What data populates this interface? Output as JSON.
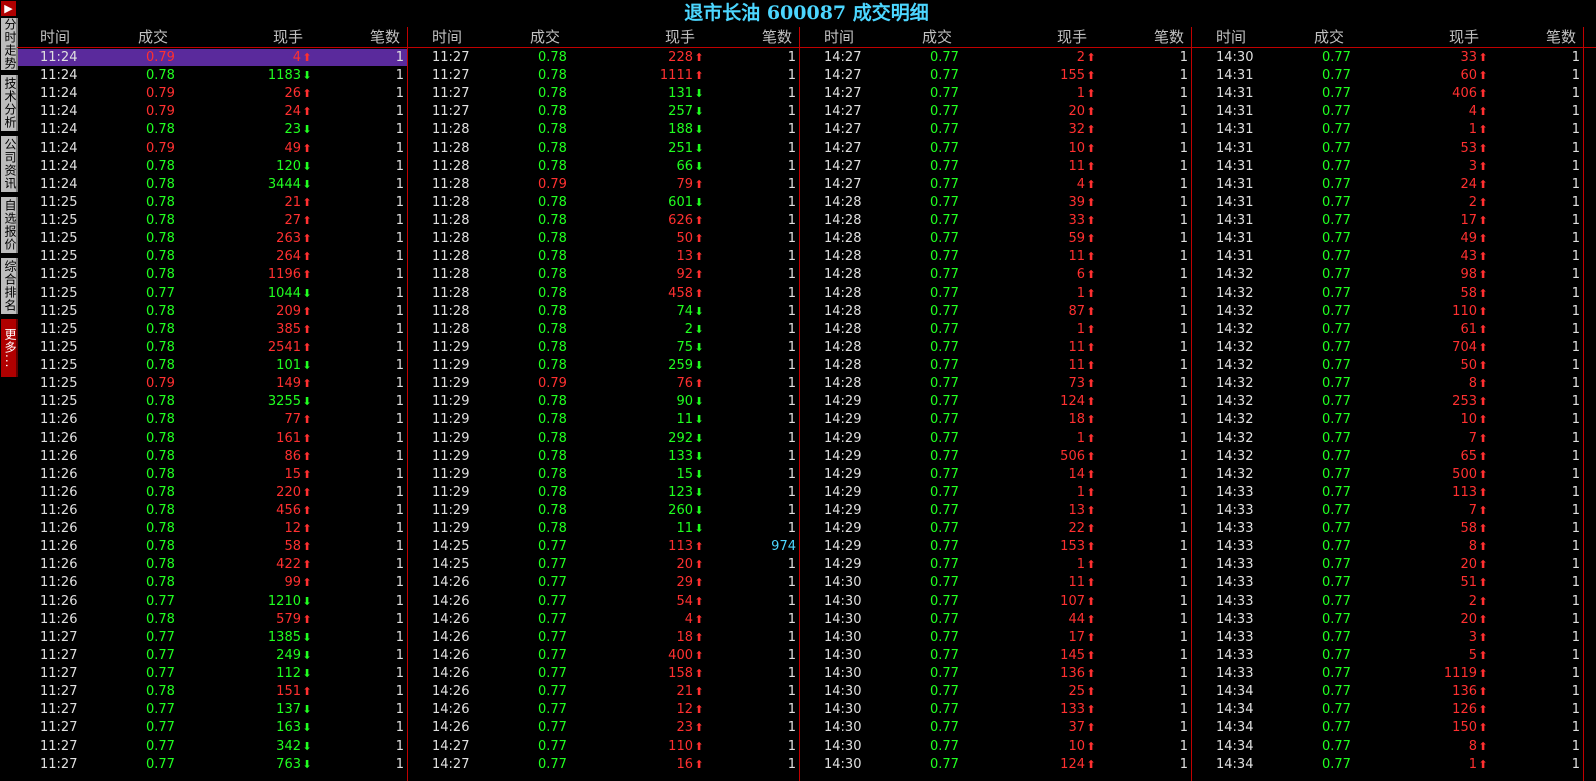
{
  "title": "退市长油 600087 成交明细",
  "sidebar": {
    "top_icon": "exit-icon",
    "tabs": [
      "分时走势",
      "技术分析",
      "公司资讯",
      "自选报价",
      "综合排名",
      "更多..."
    ]
  },
  "headers": [
    "时间",
    "成交",
    "现手",
    "笔数"
  ],
  "colors": {
    "up": "#ff3030",
    "down": "#20ff20",
    "title": "#4cd6ff",
    "divider": "#c00000",
    "highlight": "#5a2a9c"
  },
  "columns": [
    [
      [
        "11:24",
        "0.79",
        "4",
        "u",
        "1"
      ],
      [
        "11:24",
        "0.78",
        "1183",
        "d",
        "1"
      ],
      [
        "11:24",
        "0.79",
        "26",
        "u",
        "1"
      ],
      [
        "11:24",
        "0.79",
        "24",
        "u",
        "1"
      ],
      [
        "11:24",
        "0.78",
        "23",
        "d",
        "1"
      ],
      [
        "11:24",
        "0.79",
        "49",
        "u",
        "1"
      ],
      [
        "11:24",
        "0.78",
        "120",
        "d",
        "1"
      ],
      [
        "11:24",
        "0.78",
        "3444",
        "d",
        "1"
      ],
      [
        "11:25",
        "0.78",
        "21",
        "u",
        "1"
      ],
      [
        "11:25",
        "0.78",
        "27",
        "u",
        "1"
      ],
      [
        "11:25",
        "0.78",
        "263",
        "u",
        "1"
      ],
      [
        "11:25",
        "0.78",
        "264",
        "u",
        "1"
      ],
      [
        "11:25",
        "0.78",
        "1196",
        "u",
        "1"
      ],
      [
        "11:25",
        "0.77",
        "1044",
        "d",
        "1"
      ],
      [
        "11:25",
        "0.78",
        "209",
        "u",
        "1"
      ],
      [
        "11:25",
        "0.78",
        "385",
        "u",
        "1"
      ],
      [
        "11:25",
        "0.78",
        "2541",
        "u",
        "1"
      ],
      [
        "11:25",
        "0.78",
        "101",
        "d",
        "1"
      ],
      [
        "11:25",
        "0.79",
        "149",
        "u",
        "1"
      ],
      [
        "11:25",
        "0.78",
        "3255",
        "d",
        "1"
      ],
      [
        "11:26",
        "0.78",
        "77",
        "u",
        "1"
      ],
      [
        "11:26",
        "0.78",
        "161",
        "u",
        "1"
      ],
      [
        "11:26",
        "0.78",
        "86",
        "u",
        "1"
      ],
      [
        "11:26",
        "0.78",
        "15",
        "u",
        "1"
      ],
      [
        "11:26",
        "0.78",
        "220",
        "u",
        "1"
      ],
      [
        "11:26",
        "0.78",
        "456",
        "u",
        "1"
      ],
      [
        "11:26",
        "0.78",
        "12",
        "u",
        "1"
      ],
      [
        "11:26",
        "0.78",
        "58",
        "u",
        "1"
      ],
      [
        "11:26",
        "0.78",
        "422",
        "u",
        "1"
      ],
      [
        "11:26",
        "0.78",
        "99",
        "u",
        "1"
      ],
      [
        "11:26",
        "0.77",
        "1210",
        "d",
        "1"
      ],
      [
        "11:26",
        "0.78",
        "579",
        "u",
        "1"
      ],
      [
        "11:27",
        "0.77",
        "1385",
        "d",
        "1"
      ],
      [
        "11:27",
        "0.77",
        "249",
        "d",
        "1"
      ],
      [
        "11:27",
        "0.77",
        "112",
        "d",
        "1"
      ],
      [
        "11:27",
        "0.78",
        "151",
        "u",
        "1"
      ],
      [
        "11:27",
        "0.77",
        "137",
        "d",
        "1"
      ],
      [
        "11:27",
        "0.77",
        "163",
        "d",
        "1"
      ],
      [
        "11:27",
        "0.77",
        "342",
        "d",
        "1"
      ],
      [
        "11:27",
        "0.77",
        "763",
        "d",
        "1"
      ]
    ],
    [
      [
        "11:27",
        "0.78",
        "228",
        "u",
        "1"
      ],
      [
        "11:27",
        "0.78",
        "1111",
        "u",
        "1"
      ],
      [
        "11:27",
        "0.78",
        "131",
        "d",
        "1"
      ],
      [
        "11:27",
        "0.78",
        "257",
        "d",
        "1"
      ],
      [
        "11:28",
        "0.78",
        "188",
        "d",
        "1"
      ],
      [
        "11:28",
        "0.78",
        "251",
        "d",
        "1"
      ],
      [
        "11:28",
        "0.78",
        "66",
        "d",
        "1"
      ],
      [
        "11:28",
        "0.79",
        "79",
        "u",
        "1"
      ],
      [
        "11:28",
        "0.78",
        "601",
        "d",
        "1"
      ],
      [
        "11:28",
        "0.78",
        "626",
        "u",
        "1"
      ],
      [
        "11:28",
        "0.78",
        "50",
        "u",
        "1"
      ],
      [
        "11:28",
        "0.78",
        "13",
        "u",
        "1"
      ],
      [
        "11:28",
        "0.78",
        "92",
        "u",
        "1"
      ],
      [
        "11:28",
        "0.78",
        "458",
        "u",
        "1"
      ],
      [
        "11:28",
        "0.78",
        "74",
        "d",
        "1"
      ],
      [
        "11:28",
        "0.78",
        "2",
        "d",
        "1"
      ],
      [
        "11:29",
        "0.78",
        "75",
        "d",
        "1"
      ],
      [
        "11:29",
        "0.78",
        "259",
        "d",
        "1"
      ],
      [
        "11:29",
        "0.79",
        "76",
        "u",
        "1"
      ],
      [
        "11:29",
        "0.78",
        "90",
        "d",
        "1"
      ],
      [
        "11:29",
        "0.78",
        "11",
        "d",
        "1"
      ],
      [
        "11:29",
        "0.78",
        "292",
        "d",
        "1"
      ],
      [
        "11:29",
        "0.78",
        "133",
        "d",
        "1"
      ],
      [
        "11:29",
        "0.78",
        "15",
        "d",
        "1"
      ],
      [
        "11:29",
        "0.78",
        "123",
        "d",
        "1"
      ],
      [
        "11:29",
        "0.78",
        "260",
        "d",
        "1"
      ],
      [
        "11:29",
        "0.78",
        "11",
        "d",
        "1"
      ],
      [
        "14:25",
        "0.77",
        "113",
        "u",
        "974"
      ],
      [
        "14:25",
        "0.77",
        "20",
        "u",
        "1"
      ],
      [
        "14:26",
        "0.77",
        "29",
        "u",
        "1"
      ],
      [
        "14:26",
        "0.77",
        "54",
        "u",
        "1"
      ],
      [
        "14:26",
        "0.77",
        "4",
        "u",
        "1"
      ],
      [
        "14:26",
        "0.77",
        "18",
        "u",
        "1"
      ],
      [
        "14:26",
        "0.77",
        "400",
        "u",
        "1"
      ],
      [
        "14:26",
        "0.77",
        "158",
        "u",
        "1"
      ],
      [
        "14:26",
        "0.77",
        "21",
        "u",
        "1"
      ],
      [
        "14:26",
        "0.77",
        "12",
        "u",
        "1"
      ],
      [
        "14:26",
        "0.77",
        "23",
        "u",
        "1"
      ],
      [
        "14:27",
        "0.77",
        "110",
        "u",
        "1"
      ],
      [
        "14:27",
        "0.77",
        "16",
        "u",
        "1"
      ]
    ],
    [
      [
        "14:27",
        "0.77",
        "2",
        "u",
        "1"
      ],
      [
        "14:27",
        "0.77",
        "155",
        "u",
        "1"
      ],
      [
        "14:27",
        "0.77",
        "1",
        "u",
        "1"
      ],
      [
        "14:27",
        "0.77",
        "20",
        "u",
        "1"
      ],
      [
        "14:27",
        "0.77",
        "32",
        "u",
        "1"
      ],
      [
        "14:27",
        "0.77",
        "10",
        "u",
        "1"
      ],
      [
        "14:27",
        "0.77",
        "11",
        "u",
        "1"
      ],
      [
        "14:27",
        "0.77",
        "4",
        "u",
        "1"
      ],
      [
        "14:28",
        "0.77",
        "39",
        "u",
        "1"
      ],
      [
        "14:28",
        "0.77",
        "33",
        "u",
        "1"
      ],
      [
        "14:28",
        "0.77",
        "59",
        "u",
        "1"
      ],
      [
        "14:28",
        "0.77",
        "11",
        "u",
        "1"
      ],
      [
        "14:28",
        "0.77",
        "6",
        "u",
        "1"
      ],
      [
        "14:28",
        "0.77",
        "1",
        "u",
        "1"
      ],
      [
        "14:28",
        "0.77",
        "87",
        "u",
        "1"
      ],
      [
        "14:28",
        "0.77",
        "1",
        "u",
        "1"
      ],
      [
        "14:28",
        "0.77",
        "11",
        "u",
        "1"
      ],
      [
        "14:28",
        "0.77",
        "11",
        "u",
        "1"
      ],
      [
        "14:28",
        "0.77",
        "73",
        "u",
        "1"
      ],
      [
        "14:29",
        "0.77",
        "124",
        "u",
        "1"
      ],
      [
        "14:29",
        "0.77",
        "18",
        "u",
        "1"
      ],
      [
        "14:29",
        "0.77",
        "1",
        "u",
        "1"
      ],
      [
        "14:29",
        "0.77",
        "506",
        "u",
        "1"
      ],
      [
        "14:29",
        "0.77",
        "14",
        "u",
        "1"
      ],
      [
        "14:29",
        "0.77",
        "1",
        "u",
        "1"
      ],
      [
        "14:29",
        "0.77",
        "13",
        "u",
        "1"
      ],
      [
        "14:29",
        "0.77",
        "22",
        "u",
        "1"
      ],
      [
        "14:29",
        "0.77",
        "153",
        "u",
        "1"
      ],
      [
        "14:29",
        "0.77",
        "1",
        "u",
        "1"
      ],
      [
        "14:30",
        "0.77",
        "11",
        "u",
        "1"
      ],
      [
        "14:30",
        "0.77",
        "107",
        "u",
        "1"
      ],
      [
        "14:30",
        "0.77",
        "44",
        "u",
        "1"
      ],
      [
        "14:30",
        "0.77",
        "17",
        "u",
        "1"
      ],
      [
        "14:30",
        "0.77",
        "145",
        "u",
        "1"
      ],
      [
        "14:30",
        "0.77",
        "136",
        "u",
        "1"
      ],
      [
        "14:30",
        "0.77",
        "25",
        "u",
        "1"
      ],
      [
        "14:30",
        "0.77",
        "133",
        "u",
        "1"
      ],
      [
        "14:30",
        "0.77",
        "37",
        "u",
        "1"
      ],
      [
        "14:30",
        "0.77",
        "10",
        "u",
        "1"
      ],
      [
        "14:30",
        "0.77",
        "124",
        "u",
        "1"
      ]
    ],
    [
      [
        "14:30",
        "0.77",
        "33",
        "u",
        "1"
      ],
      [
        "14:31",
        "0.77",
        "60",
        "u",
        "1"
      ],
      [
        "14:31",
        "0.77",
        "406",
        "u",
        "1"
      ],
      [
        "14:31",
        "0.77",
        "4",
        "u",
        "1"
      ],
      [
        "14:31",
        "0.77",
        "1",
        "u",
        "1"
      ],
      [
        "14:31",
        "0.77",
        "53",
        "u",
        "1"
      ],
      [
        "14:31",
        "0.77",
        "3",
        "u",
        "1"
      ],
      [
        "14:31",
        "0.77",
        "24",
        "u",
        "1"
      ],
      [
        "14:31",
        "0.77",
        "2",
        "u",
        "1"
      ],
      [
        "14:31",
        "0.77",
        "17",
        "u",
        "1"
      ],
      [
        "14:31",
        "0.77",
        "49",
        "u",
        "1"
      ],
      [
        "14:31",
        "0.77",
        "43",
        "u",
        "1"
      ],
      [
        "14:32",
        "0.77",
        "98",
        "u",
        "1"
      ],
      [
        "14:32",
        "0.77",
        "58",
        "u",
        "1"
      ],
      [
        "14:32",
        "0.77",
        "110",
        "u",
        "1"
      ],
      [
        "14:32",
        "0.77",
        "61",
        "u",
        "1"
      ],
      [
        "14:32",
        "0.77",
        "704",
        "u",
        "1"
      ],
      [
        "14:32",
        "0.77",
        "50",
        "u",
        "1"
      ],
      [
        "14:32",
        "0.77",
        "8",
        "u",
        "1"
      ],
      [
        "14:32",
        "0.77",
        "253",
        "u",
        "1"
      ],
      [
        "14:32",
        "0.77",
        "10",
        "u",
        "1"
      ],
      [
        "14:32",
        "0.77",
        "7",
        "u",
        "1"
      ],
      [
        "14:32",
        "0.77",
        "65",
        "u",
        "1"
      ],
      [
        "14:32",
        "0.77",
        "500",
        "u",
        "1"
      ],
      [
        "14:33",
        "0.77",
        "113",
        "u",
        "1"
      ],
      [
        "14:33",
        "0.77",
        "7",
        "u",
        "1"
      ],
      [
        "14:33",
        "0.77",
        "58",
        "u",
        "1"
      ],
      [
        "14:33",
        "0.77",
        "8",
        "u",
        "1"
      ],
      [
        "14:33",
        "0.77",
        "20",
        "u",
        "1"
      ],
      [
        "14:33",
        "0.77",
        "51",
        "u",
        "1"
      ],
      [
        "14:33",
        "0.77",
        "2",
        "u",
        "1"
      ],
      [
        "14:33",
        "0.77",
        "20",
        "u",
        "1"
      ],
      [
        "14:33",
        "0.77",
        "3",
        "u",
        "1"
      ],
      [
        "14:33",
        "0.77",
        "5",
        "u",
        "1"
      ],
      [
        "14:33",
        "0.77",
        "1119",
        "u",
        "1"
      ],
      [
        "14:34",
        "0.77",
        "136",
        "u",
        "1"
      ],
      [
        "14:34",
        "0.77",
        "126",
        "u",
        "1"
      ],
      [
        "14:34",
        "0.77",
        "150",
        "u",
        "1"
      ],
      [
        "14:34",
        "0.77",
        "8",
        "u",
        "1"
      ],
      [
        "14:34",
        "0.77",
        "1",
        "u",
        "1"
      ]
    ]
  ]
}
